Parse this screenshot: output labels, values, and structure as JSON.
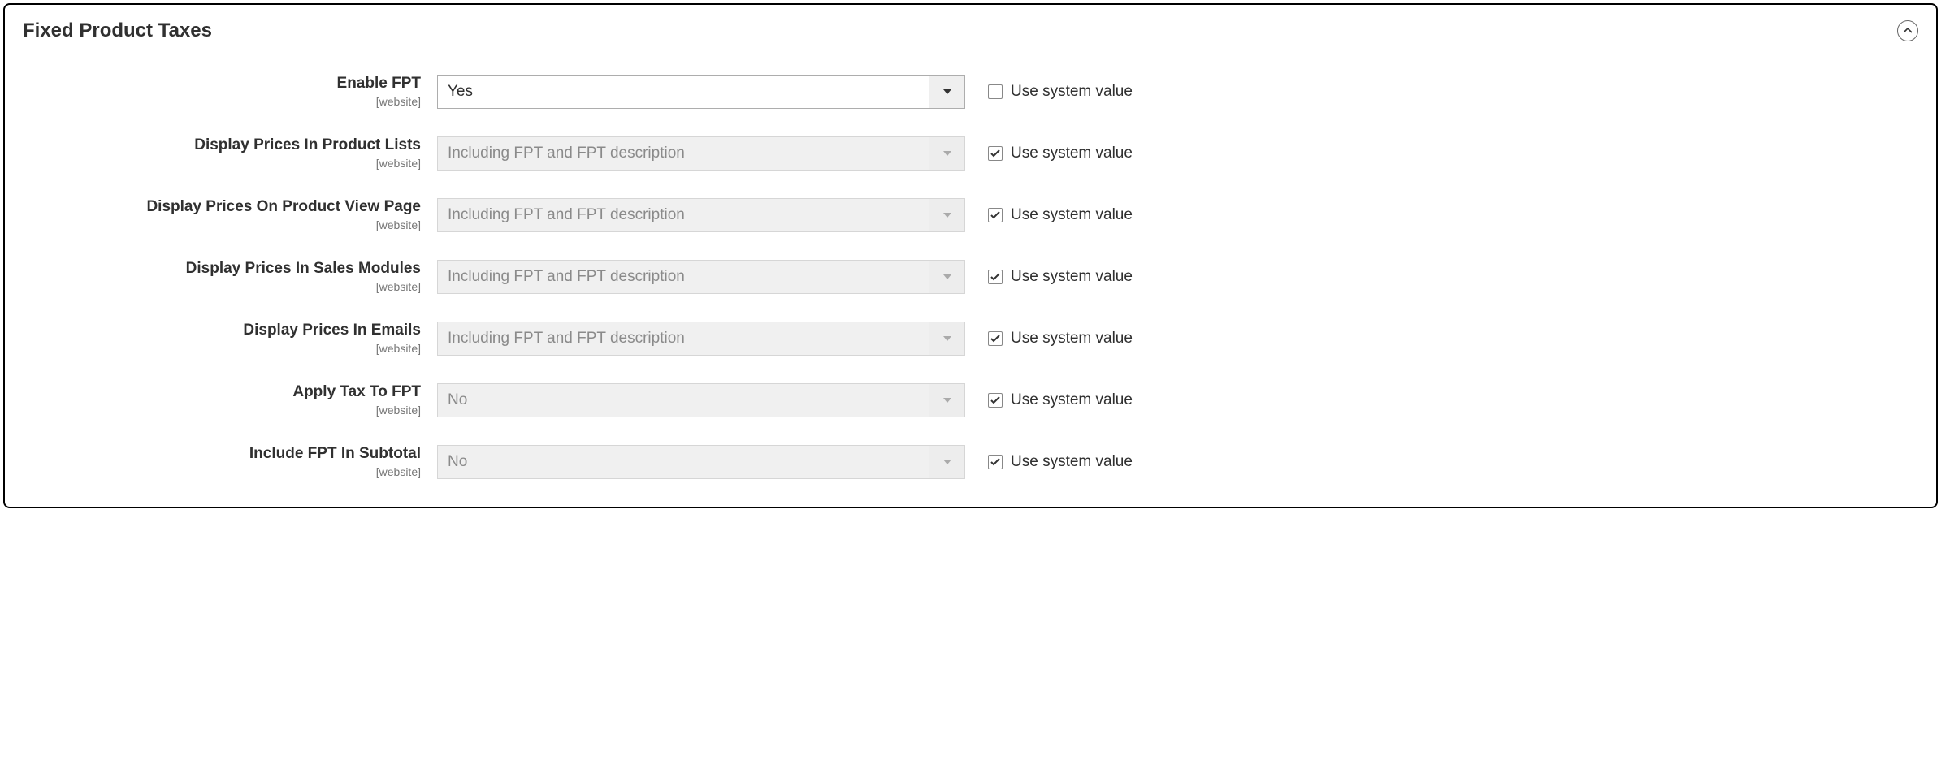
{
  "section": {
    "title": "Fixed Product Taxes",
    "scope_label": "[website]",
    "use_system_label": "Use system value"
  },
  "fields": [
    {
      "id": "enable-fpt",
      "label": "Enable FPT",
      "value": "Yes",
      "use_system": false,
      "disabled": false
    },
    {
      "id": "display-prices-product-lists",
      "label": "Display Prices In Product Lists",
      "value": "Including FPT and FPT description",
      "use_system": true,
      "disabled": true
    },
    {
      "id": "display-prices-product-view",
      "label": "Display Prices On Product View Page",
      "value": "Including FPT and FPT description",
      "use_system": true,
      "disabled": true
    },
    {
      "id": "display-prices-sales-modules",
      "label": "Display Prices In Sales Modules",
      "value": "Including FPT and FPT description",
      "use_system": true,
      "disabled": true
    },
    {
      "id": "display-prices-emails",
      "label": "Display Prices In Emails",
      "value": "Including FPT and FPT description",
      "use_system": true,
      "disabled": true
    },
    {
      "id": "apply-tax-to-fpt",
      "label": "Apply Tax To FPT",
      "value": "No",
      "use_system": true,
      "disabled": true
    },
    {
      "id": "include-fpt-in-subtotal",
      "label": "Include FPT In Subtotal",
      "value": "No",
      "use_system": true,
      "disabled": true
    }
  ]
}
